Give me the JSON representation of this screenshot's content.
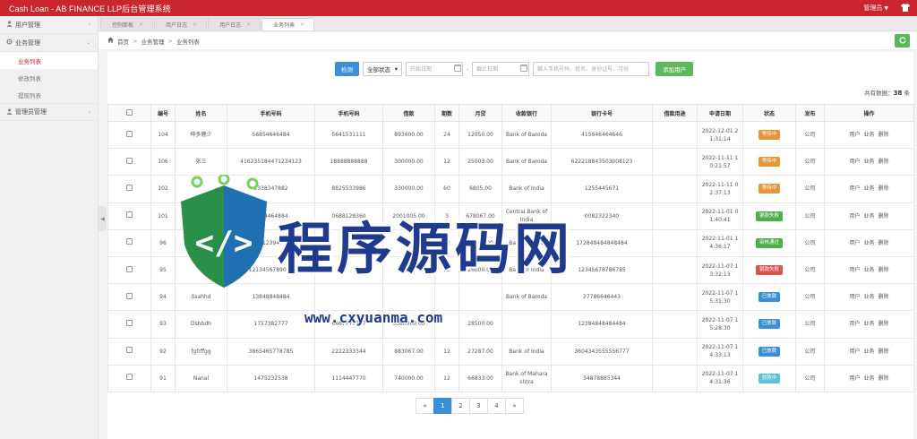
{
  "app": {
    "title": "Cash Loan - AB FINANCE LLP后台管理系统",
    "user": "管理员",
    "shirt_icon": "shirt-icon"
  },
  "sidebar": {
    "groups": [
      {
        "label": "用户管理",
        "icon": "user-icon"
      },
      {
        "label": "业务管理",
        "icon": "gear-icon"
      },
      {
        "label": "管理员管理",
        "icon": "admin-icon"
      }
    ],
    "items": [
      {
        "label": "业务列表",
        "active": true
      },
      {
        "label": "修改列表"
      },
      {
        "label": "提现列表"
      }
    ]
  },
  "tabs": [
    {
      "label": "控制面板"
    },
    {
      "label": "用户日志"
    },
    {
      "label": "用户日志"
    },
    {
      "label": "业务列表",
      "active": true
    }
  ],
  "breadcrumb": {
    "home": "首页",
    "section": "业务管理",
    "page": "业务列表"
  },
  "filters": {
    "search_label": "检测",
    "status_select": "全部状态",
    "start_date_placeholder": "开始日期",
    "end_date_placeholder": "截止日期",
    "keyword_placeholder": "输入手机号码、姓名、身份证号、月份",
    "add_label": "添加用户",
    "dash": "-"
  },
  "total": {
    "label": "共有数据：",
    "count": "38",
    "unit": "条"
  },
  "table": {
    "headers": [
      "",
      "编号",
      "姓名",
      "手机号码",
      "手机号码",
      "借款",
      "期数",
      "月贷",
      "收款银行",
      "银行卡号",
      "借款用途",
      "申请日期",
      "状态",
      "发布",
      "操作"
    ],
    "actions": [
      "用户",
      "业务",
      "删除"
    ],
    "rows": [
      {
        "id": "104",
        "name": "伸多鹿少",
        "phone1": "56854646484",
        "phone2": "5641531111",
        "amount": "893600.00",
        "term": "24",
        "monthly": "12050.00",
        "bank": "Bank of Baroda",
        "account": "415646464646",
        "purpose": "",
        "date": "2022-12-01 21:31:14",
        "status": "等待中",
        "status_color": "#e8943a",
        "publish": "公司"
      },
      {
        "id": "106",
        "name": "张三",
        "phone1": "416235184471234123",
        "phone2": "18888888888",
        "amount": "300000.00",
        "term": "12",
        "monthly": "25003.00",
        "bank": "Bank of Baroda",
        "account": "622218843503008123",
        "purpose": "",
        "date": "2022-11-11 10:21:57",
        "status": "等待中",
        "status_color": "#e8943a",
        "publish": "公司"
      },
      {
        "id": "102",
        "name": "",
        "phone1": "1338347882",
        "phone2": "8825533986",
        "amount": "330000.00",
        "term": "60",
        "monthly": "6805.00",
        "bank": "Bank of India",
        "account": "1255445671",
        "purpose": "",
        "date": "2022-11-11 02:37:13",
        "status": "等待中",
        "status_color": "#e8943a",
        "publish": "公司"
      },
      {
        "id": "101",
        "name": "",
        "phone1": "3864464884",
        "phone2": "0688128360",
        "amount": "2001005.00",
        "term": "3",
        "monthly": "678067.00",
        "bank": "Central Bank of India",
        "account": "0082322340",
        "purpose": "",
        "date": "2022-11-01 01:40:41",
        "status": "银款失败",
        "status_color": "#4cae4c",
        "publish": "公司"
      },
      {
        "id": "96",
        "name": "",
        "phone1": "12394",
        "phone2": "",
        "amount": "",
        "term": "12",
        "monthly": "28030.00",
        "bank": "Bank of India",
        "account": "172848484848484",
        "purpose": "",
        "date": "2022-11-01 14:36:17",
        "status": "审核通过",
        "status_color": "#4cae4c",
        "publish": "公司"
      },
      {
        "id": "95",
        "name": "",
        "phone1": "1213456789000",
        "phone2": "",
        "amount": "",
        "term": "12",
        "monthly": "26000.00",
        "bank": "Bank of India",
        "account": "12345678786785",
        "purpose": "",
        "date": "2022-11-07 13:32:13",
        "status": "银款失败",
        "status_color": "#d9534f",
        "publish": "公司"
      },
      {
        "id": "94",
        "name": "Ssahhd",
        "phone1": "13848848484",
        "phone2": "",
        "amount": "",
        "term": "",
        "monthly": "",
        "bank": "Bank of Baroda",
        "account": "27786646443",
        "purpose": "",
        "date": "2022-11-07 15:31:30",
        "status": "已放款",
        "status_color": "#3b8fd6",
        "publish": "公司"
      },
      {
        "id": "93",
        "name": "Dshbdh",
        "phone1": "1757382777",
        "phone2": "6667777777",
        "amount": "3380000.00",
        "term": "",
        "monthly": "28500.00",
        "bank": "",
        "account": "12384848484484",
        "purpose": "",
        "date": "2022-11-07 15:28:30",
        "status": "已放款",
        "status_color": "#3b8fd6",
        "publish": "公司"
      },
      {
        "id": "92",
        "name": "fgfrffgg",
        "phone1": "3865465778785",
        "phone2": "2222333344",
        "amount": "883067.00",
        "term": "12",
        "monthly": "27287.00",
        "bank": "Bank of India",
        "account": "3604343555556777",
        "purpose": "",
        "date": "2022-11-07 14:33:13",
        "status": "已放款",
        "status_color": "#3b8fd6",
        "publish": "公司"
      },
      {
        "id": "91",
        "name": "Nanal",
        "phone1": "1475232538",
        "phone2": "1114447770",
        "amount": "740000.00",
        "term": "12",
        "monthly": "66833.00",
        "bank": "Bank of Maharashtra",
        "account": "34878885344",
        "purpose": "",
        "date": "2022-11-07 14:31:36",
        "status": "放款中",
        "status_color": "#5bc0de",
        "publish": "公司"
      }
    ]
  },
  "pagination": {
    "prev": "«",
    "pages": [
      "1",
      "2",
      "3",
      "4"
    ],
    "next": "»",
    "current": "1"
  },
  "watermark": {
    "text": "程序源码网",
    "url": "www.cxyuanma.com"
  }
}
